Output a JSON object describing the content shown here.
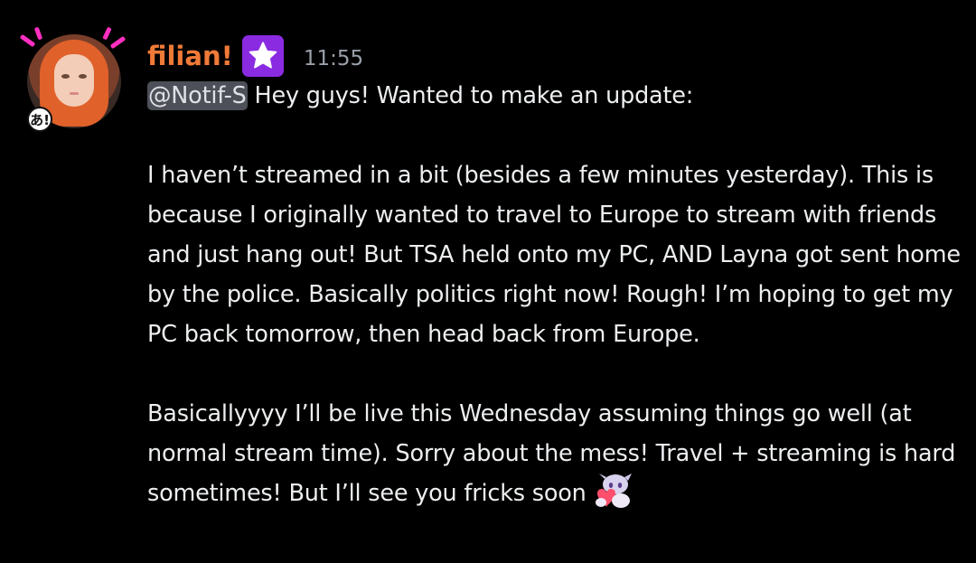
{
  "message": {
    "author": {
      "name": "filian!",
      "name_color": "#f07a38",
      "avatar_icon": "avatar-image",
      "avatar_decoration_text": "あ!",
      "role_icon": "star-icon",
      "role_icon_color": "#8a2be2"
    },
    "timestamp": "11:55",
    "mention": "@Notif-S",
    "paragraphs": [
      " Hey guys! Wanted to make an update:",
      "I haven’t streamed in a bit (besides a few minutes yesterday). This is because I originally wanted to travel to Europe to stream with friends and just hang out! But TSA held onto my PC, AND Layna got sent home by the police. Basically politics right now! Rough! I’m hoping to get my PC back tomorrow, then head back from Europe.",
      "Basicallyyyy I’ll be live this Wednesday assuming things go well (at normal stream time). Sorry about the mess! Travel + streaming is hard sometimes! But I’ll see you fricks soon"
    ],
    "custom_emoji": "heart-hug-emoji"
  }
}
